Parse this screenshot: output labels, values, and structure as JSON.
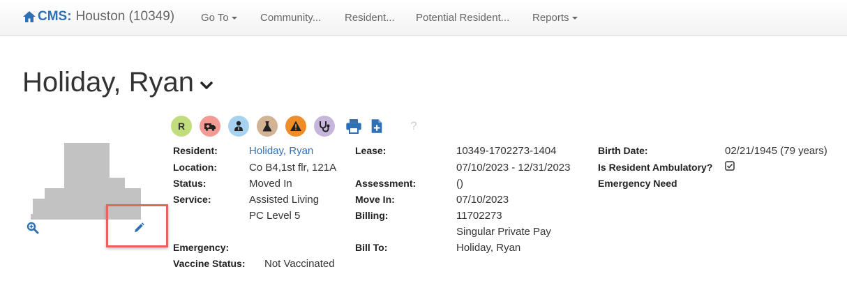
{
  "navbar": {
    "brand_cms": "CMS:",
    "brand_site": "Houston (10349)",
    "items": [
      {
        "label": "Go To"
      },
      {
        "label": "Community..."
      },
      {
        "label": "Resident..."
      },
      {
        "label": "Potential Resident..."
      },
      {
        "label": "Reports"
      }
    ]
  },
  "page": {
    "title": "Holiday, Ryan"
  },
  "icons": [
    {
      "name": "resident-r-icon",
      "text": "R",
      "bg": "#c2dd7e"
    },
    {
      "name": "ambulance-icon",
      "bg": "#f39a93"
    },
    {
      "name": "doctor-icon",
      "bg": "#a7d2ef"
    },
    {
      "name": "flask-icon",
      "bg": "#d2b394"
    },
    {
      "name": "warning-icon",
      "bg": "#ef8e28"
    },
    {
      "name": "stethoscope-icon",
      "bg": "#c6b6dc"
    },
    {
      "name": "print-icon"
    },
    {
      "name": "add-document-icon"
    },
    {
      "name": "help-icon",
      "text": "?"
    }
  ],
  "details": {
    "resident_label": "Resident:",
    "resident_value": "Holiday, Ryan",
    "location_label": "Location:",
    "location_value": "Co B4,1st flr, 121A",
    "status_label": "Status:",
    "status_value": "Moved In",
    "service_label": "Service:",
    "service_value": "Assisted Living",
    "service_value2": "PC Level 5",
    "emergency_label": "Emergency:",
    "vaccine_label": "Vaccine Status:",
    "vaccine_value": "Not Vaccinated",
    "lease_label": "Lease:",
    "lease_value": "10349-1702273-1404",
    "lease_dates": "07/10/2023 - 12/31/2023",
    "assessment_label": "Assessment:",
    "assessment_value": "()",
    "movein_label": "Move In:",
    "movein_value": "07/10/2023",
    "billing_label": "Billing:",
    "billing_value": "11702273",
    "billing_value2": "Singular Private Pay",
    "billto_label": "Bill To:",
    "billto_value": "Holiday, Ryan",
    "birthdate_label": "Birth Date:",
    "birthdate_value": "02/21/1945 (79 years)",
    "ambulatory_label": "Is Resident Ambulatory?",
    "ambulatory_checked": true,
    "emergency_need_label": "Emergency Need"
  },
  "colors": {
    "accent": "#2f6fb3",
    "highlight": "#e8645b"
  }
}
